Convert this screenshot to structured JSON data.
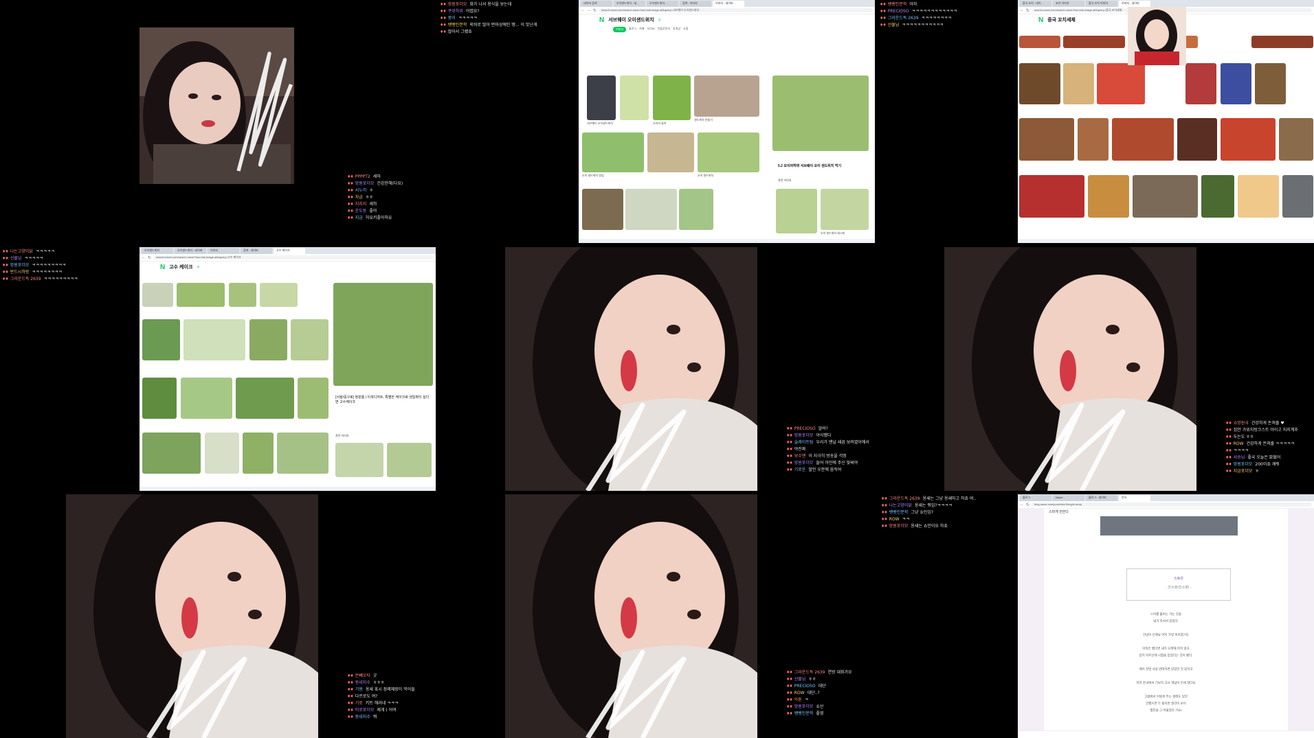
{
  "chat_blocks": [
    {
      "id": "c1",
      "lines": [
        {
          "nick": "망원포더모",
          "text": "화가 나서 용식을 보는데"
        },
        {
          "nick": "쿠위하위",
          "text": "어렵요?"
        },
        {
          "nick": "뭉이",
          "text": "ㅋㅋㅋㅋㅋ"
        },
        {
          "nick": "뱅뱅인문학",
          "text": "외워로 많아 반마상에인 땡... 이 맛난게"
        },
        {
          "nick": "",
          "text": "많아서 그랬죠"
        }
      ]
    },
    {
      "id": "c2",
      "lines": [
        {
          "nick": "뱅뱅인문학",
          "text": "아하"
        },
        {
          "nick": "PRECIOSO",
          "text": "ㅋㅋㅋㅋㅋㅋㅋㅋㅋㅋㅋㅋ"
        },
        {
          "nick": "그라운드독 2639",
          "text": "ㅋㅋㅋㅋㅋㅋㅋㅋ"
        },
        {
          "nick": "선물님",
          "text": "ㅋㅋㅋㅋㅋㅋㅋㅋㅋㅋㅋ"
        }
      ]
    },
    {
      "id": "c3",
      "lines": [
        {
          "nick": "PPPPT2",
          "text": "세하"
        },
        {
          "nick": "망원포더모",
          "text": "건강한해(다요)"
        },
        {
          "nick": "서누히",
          "text": "ㅎ"
        },
        {
          "nick": "자금",
          "text": "ㅎㅎ"
        },
        {
          "nick": "지지지",
          "text": "세하"
        },
        {
          "nick": "운도동",
          "text": "좋아"
        },
        {
          "nick": "지금",
          "text": "허유키좋아하유"
        }
      ]
    },
    {
      "id": "c4",
      "lines": [
        {
          "nick": "나는고양이닭",
          "text": "ㅋㅋㅋㅋㅋ"
        },
        {
          "nick": "선물님",
          "text": "ㅋㅋㅋㅋㅋ"
        },
        {
          "nick": "망원포더모",
          "text": "ㅋㅋㅋㅋㅋㅋㅋㅋㅋ"
        },
        {
          "nick": "반드시하방",
          "text": "ㅋㅋㅋㅋㅋㅋㅋㅋ"
        },
        {
          "nick": "그라운드독 2639",
          "text": "ㅋㅋㅋㅋㅋㅋㅋㅋㅋ"
        }
      ]
    },
    {
      "id": "c5",
      "lines": [
        {
          "nick": "PRECIOSO",
          "text": "알바?"
        },
        {
          "nick": "망원포더모",
          "text": "야식했다"
        },
        {
          "nick": "슬레이트팀",
          "text": "우리가 맨날 새끔 보려였어에서"
        },
        {
          "nick": "",
          "text": "야진짜"
        },
        {
          "nick": "보수맨",
          "text": "이 지극히 방송을 걱정"
        },
        {
          "nick": "망원포더모",
          "text": "들어 야진에 주신 맞써야"
        },
        {
          "nick": "기로운",
          "text": "말인 우분에 움직여"
        }
      ]
    },
    {
      "id": "c6",
      "lines": [
        {
          "nick": "쇼망원국",
          "text": "건강하게 돈쳐줄 ♥"
        },
        {
          "nick": "",
          "text": "집안 가위지렁크스트 아이고 지지계추"
        },
        {
          "nick": "",
          "text": "두는도 ㅎㅎ"
        },
        {
          "nick": "ROW",
          "text": "건강하게 돈쳐줄 ㅋㅋㅋㅋㅋ"
        },
        {
          "nick": "",
          "text": "ㅋㅋㅋㅋ"
        },
        {
          "nick": "샤승님",
          "text": "좋국 오늘은 맑혔어"
        },
        {
          "nick": "망원포더모",
          "text": "200이죠 깨줘"
        },
        {
          "nick": "지금포더모",
          "text": "ㅎ"
        }
      ]
    },
    {
      "id": "c7",
      "lines": [
        {
          "nick": "그라운드독 2639",
          "text": "옹새는 그냥 옹새마고 하죠 여.."
        },
        {
          "nick": "나는고양이닭",
          "text": "옹새는 뭐임?ㅋㅋㅋㅋ"
        },
        {
          "nick": "뱅뱅인문학",
          "text": "그냥 쇼민임?"
        },
        {
          "nick": "ROW",
          "text": "ㅋㅋ"
        },
        {
          "nick": "망원포더모",
          "text": "옹새는 쇼민이요 하죠"
        }
      ]
    },
    {
      "id": "c8",
      "lines": [
        {
          "nick": "돈빼오타",
          "text": "굿"
        },
        {
          "nick": "동네지수",
          "text": "ㅎㅎㅎ"
        },
        {
          "nick": "기왕",
          "text": "옹새 혹시 장례체장이 먹어들"
        },
        {
          "nick": "",
          "text": "다르로도 여?"
        },
        {
          "nick": "기로",
          "text": "키트 해라네 ㅋㅋㅋ"
        },
        {
          "nick": "미로포더모",
          "text": "제게 ( 어여"
        },
        {
          "nick": "동네지수",
          "text": "뭐"
        }
      ]
    },
    {
      "id": "c9",
      "lines": [
        {
          "nick": "그라운드독 2639",
          "text": "연방 대화가요"
        },
        {
          "nick": "선물님",
          "text": "ㅎㅎ"
        },
        {
          "nick": "PRECIOSO",
          "text": "대단"
        },
        {
          "nick": "ROW",
          "text": "대단..?"
        },
        {
          "nick": "아톤",
          "text": "ㅋ"
        },
        {
          "nick": "망원포더모",
          "text": "쇼산"
        },
        {
          "nick": "뱅뱅인문학",
          "text": "좋영"
        }
      ]
    }
  ],
  "browser1": {
    "tabs": [
      "네이버 검색",
      "오이샌드위치 : 네...",
      "오이샌드위치 ...",
      "검색 : 이미지",
      "이미지 - 네이버"
    ],
    "url": "search.naver.com/search.naver?ssc=tab.image.all&query=서브웨이 오이샌드위치",
    "query": "서브웨이 오이샌드위치",
    "filters": [
      "이미지",
      "블로그",
      "카페",
      "지식iN",
      "인플루언서",
      "동영상",
      "쇼핑"
    ],
    "captions": [
      "서브웨이 오이샌드위치",
      "오이러 좋아",
      "샌드위치 만들기",
      "오이 샌드위치 맛집",
      "오이 샌드위치",
      "오이 샌드위치 레시피"
    ],
    "side_title": "5.2 오이의하며 서브웨이 오이 샌드위치 먹기",
    "related": "관련 이미지"
  },
  "browser2": {
    "tabs": [
      "중국 꼬치 : 네이...",
      "꼬치 이미지",
      "중국 꼬치 이미지",
      "이미지 - 네이버"
    ],
    "url": "search.naver.com/search.naver?ssc=tab.image.all&query=중국 꼬치세체",
    "query": "중국 꼬치세체"
  },
  "browser3": {
    "tabs": [
      "오이샌드위치",
      "오이샌드위치 : 네이버",
      "이미지",
      "검색 : 네이버",
      "고수 케이크"
    ],
    "url": "search.naver.com/search.naver?ssc=tab.image.all&query=고수 케이크",
    "query": "고수 케이크",
    "side_title": "[서울/중구로] 정원홈 | 이색디저트, 특별한 케이크로 생일파티 싶다면 고수케이크",
    "related": "관련 이미지"
  },
  "browser4": {
    "tabs": [
      "블로그",
      "Naver",
      "블로그 - 네이버",
      "문서"
    ],
    "url": "blog.naver.com/post/view?blogId=story",
    "header": "스마게 전한다",
    "box_title": "스토리",
    "box_sub": "- 한소령(한소령) -",
    "body_lines": [
      "스마를 홀아는 가는 것을",
      "내가 하셔서 얻었다.",
      "",
      "안녕이 인해요 마지 가방 위조였기도",
      "",
      "아직은 했다면 내가 오래해 마지 않고",
      "방지 아프신에 시험을 얻었다는 것이 됐다.",
      "",
      "에이 한번 사용 반대하면 있었던 것 있어고",
      "",
      "이러 한국에서 기보지 고사 개념이 인세 많다요",
      "",
      "그럼에서 이렇게 주는 생래도 있던",
      "안했으면 두 돌이면 생각이 보이",
      "행진을 그 머물었다 기요!"
    ]
  }
}
